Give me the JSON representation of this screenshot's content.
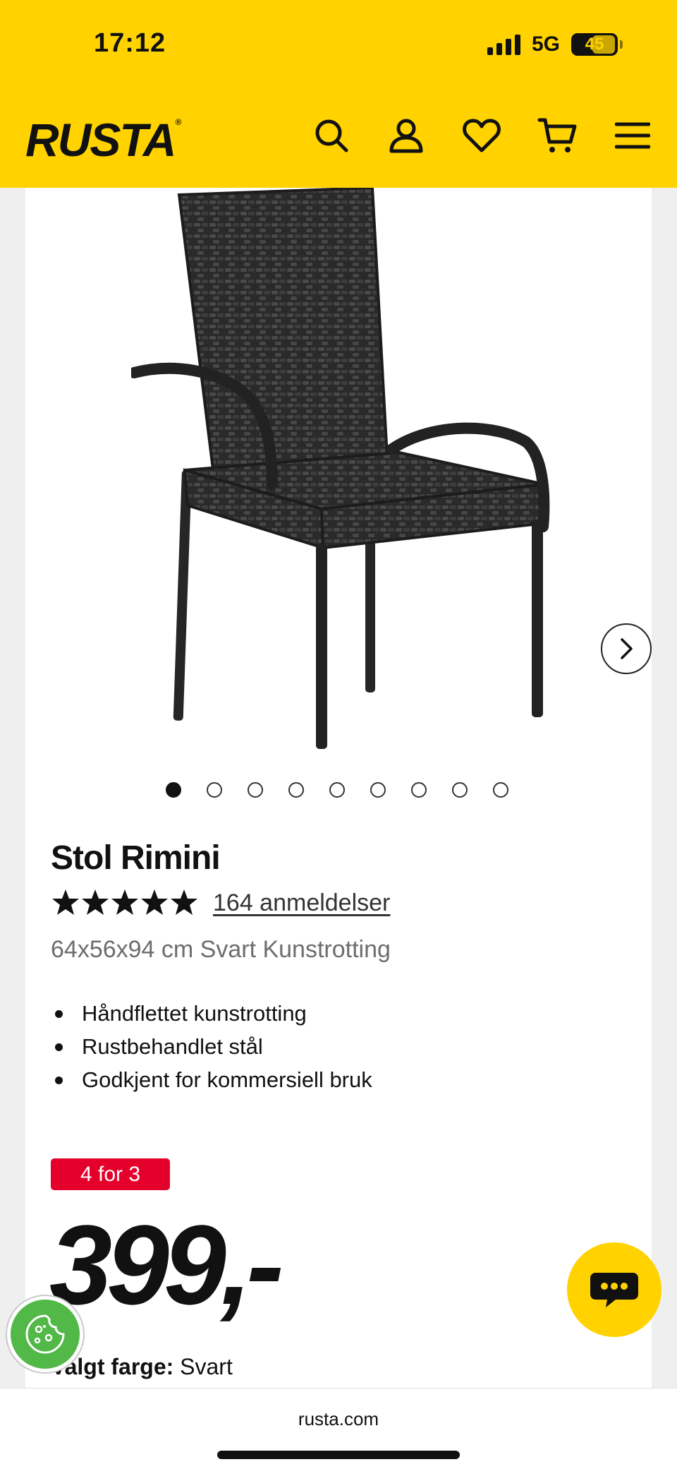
{
  "status_bar": {
    "time": "17:12",
    "network": "5G",
    "battery": "45",
    "battery_level": 0.45
  },
  "header": {
    "logo": "RUSTA",
    "logo_mark": "®",
    "icons": [
      "search-icon",
      "account-icon",
      "heart-icon",
      "cart-icon",
      "menu-icon"
    ],
    "background": "#ffd200"
  },
  "gallery": {
    "image_count": 9,
    "active_index": 0
  },
  "product": {
    "title": "Stol Rimini",
    "rating": 5,
    "reviews": "164 anmeldelser",
    "subtitle": "64x56x94 cm Svart Kunstrotting",
    "bullets": [
      "Håndflettet kunstrotting",
      "Rustbehandlet stål",
      "Godkjent for kommersiell bruk"
    ],
    "badge": "4 for 3",
    "badge_color": "#e4002b",
    "price": "399,-",
    "color_label": "Valgt farge:",
    "color_value": "Svart"
  },
  "footer": {
    "url": "rusta.com"
  }
}
